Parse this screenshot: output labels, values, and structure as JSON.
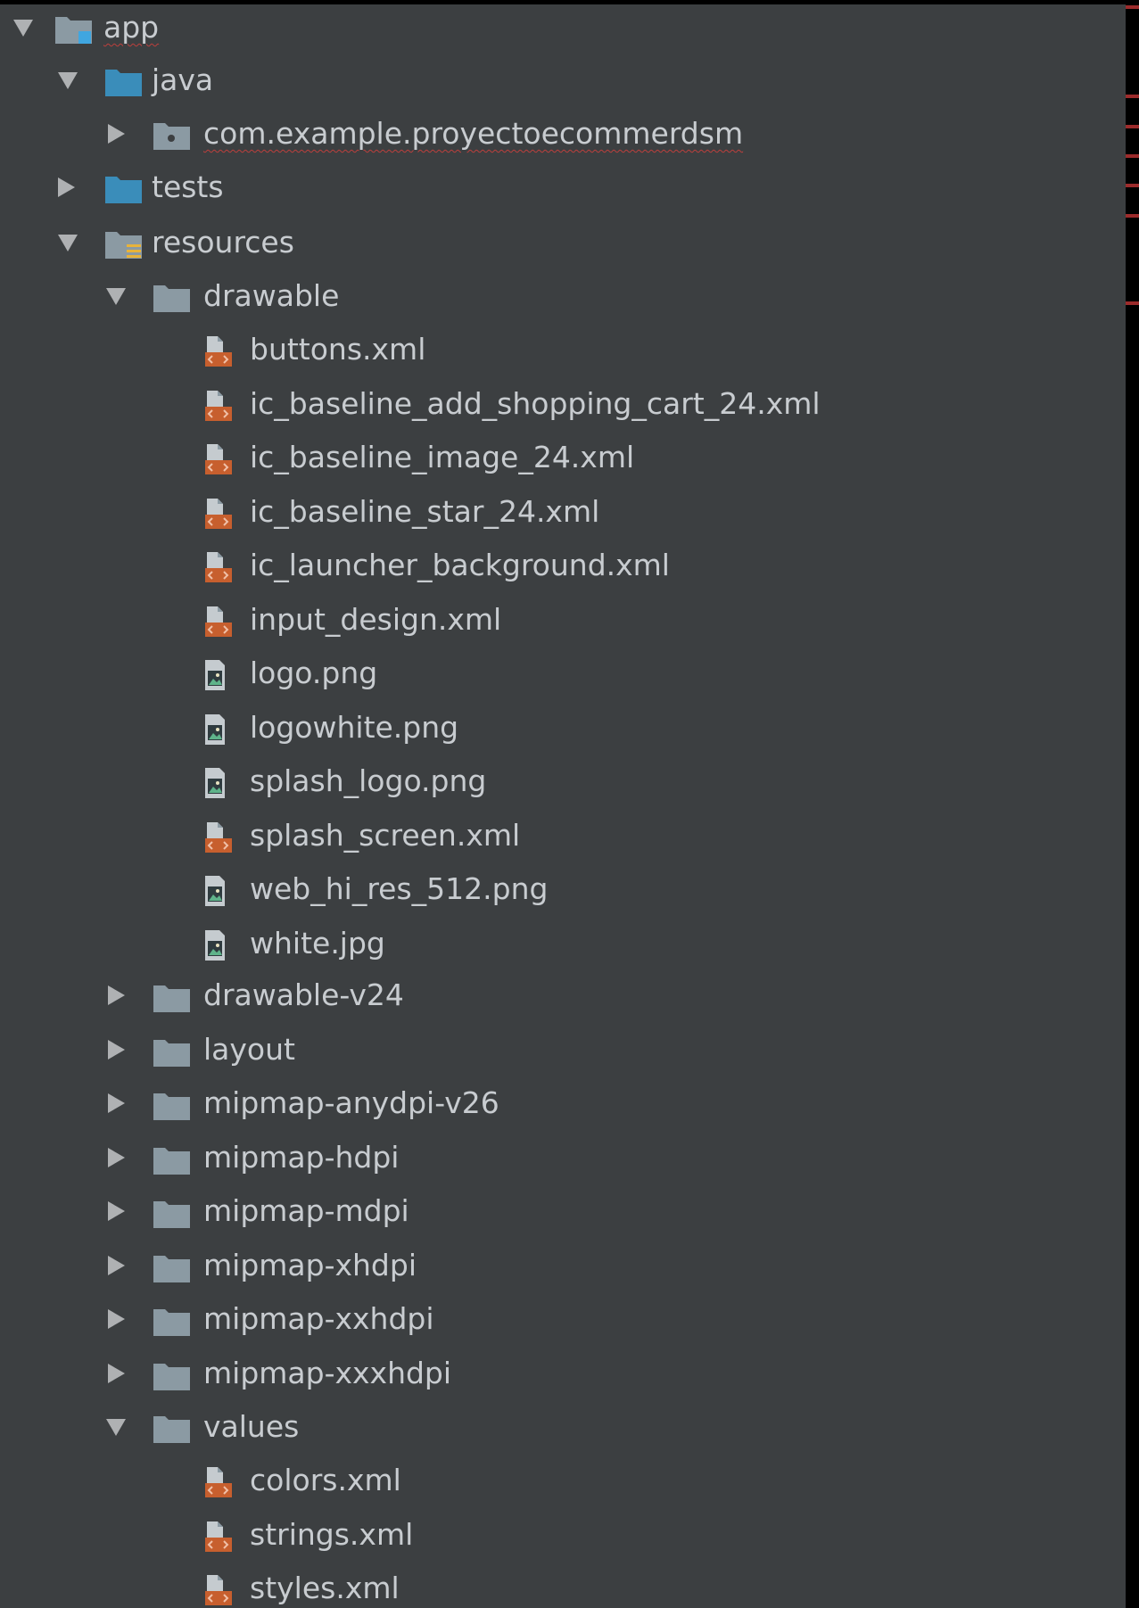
{
  "tree": {
    "root": {
      "label": "app",
      "expanded": true
    },
    "java": {
      "label": "java",
      "expanded": true
    },
    "package": {
      "label": "com.example.proyectoecommerdsm",
      "expanded": false
    },
    "tests": {
      "label": "tests",
      "expanded": false
    },
    "resources": {
      "label": "resources",
      "expanded": true
    },
    "drawable": {
      "label": "drawable",
      "expanded": true,
      "files": [
        {
          "label": "buttons.xml",
          "icon": "xml-file-icon"
        },
        {
          "label": "ic_baseline_add_shopping_cart_24.xml",
          "icon": "xml-file-icon"
        },
        {
          "label": "ic_baseline_image_24.xml",
          "icon": "xml-file-icon"
        },
        {
          "label": "ic_baseline_star_24.xml",
          "icon": "xml-file-icon"
        },
        {
          "label": "ic_launcher_background.xml",
          "icon": "xml-file-icon"
        },
        {
          "label": "input_design.xml",
          "icon": "xml-file-icon"
        },
        {
          "label": "logo.png",
          "icon": "image-file-icon"
        },
        {
          "label": "logowhite.png",
          "icon": "image-file-icon"
        },
        {
          "label": "splash_logo.png",
          "icon": "image-file-icon"
        },
        {
          "label": "splash_screen.xml",
          "icon": "xml-file-icon"
        },
        {
          "label": "web_hi_res_512.png",
          "icon": "image-file-icon"
        },
        {
          "label": "white.jpg",
          "icon": "image-file-icon"
        }
      ]
    },
    "collapsed_folders": [
      {
        "label": "drawable-v24"
      },
      {
        "label": "layout"
      },
      {
        "label": "mipmap-anydpi-v26"
      },
      {
        "label": "mipmap-hdpi"
      },
      {
        "label": "mipmap-mdpi"
      },
      {
        "label": "mipmap-xhdpi"
      },
      {
        "label": "mipmap-xxhdpi"
      },
      {
        "label": "mipmap-xxxhdpi"
      }
    ],
    "values": {
      "label": "values",
      "expanded": true,
      "files": [
        {
          "label": "colors.xml",
          "icon": "xml-file-icon"
        },
        {
          "label": "strings.xml",
          "icon": "xml-file-icon"
        },
        {
          "label": "styles.xml",
          "icon": "xml-file-icon"
        }
      ]
    }
  },
  "colors": {
    "panel_bg": "#3c3f41",
    "text": "#c8ccd0",
    "source_folder": "#3a8dba",
    "folder": "#8b9aa3",
    "xml_badge": "#c75f2e",
    "error": "#bc3f3c"
  }
}
